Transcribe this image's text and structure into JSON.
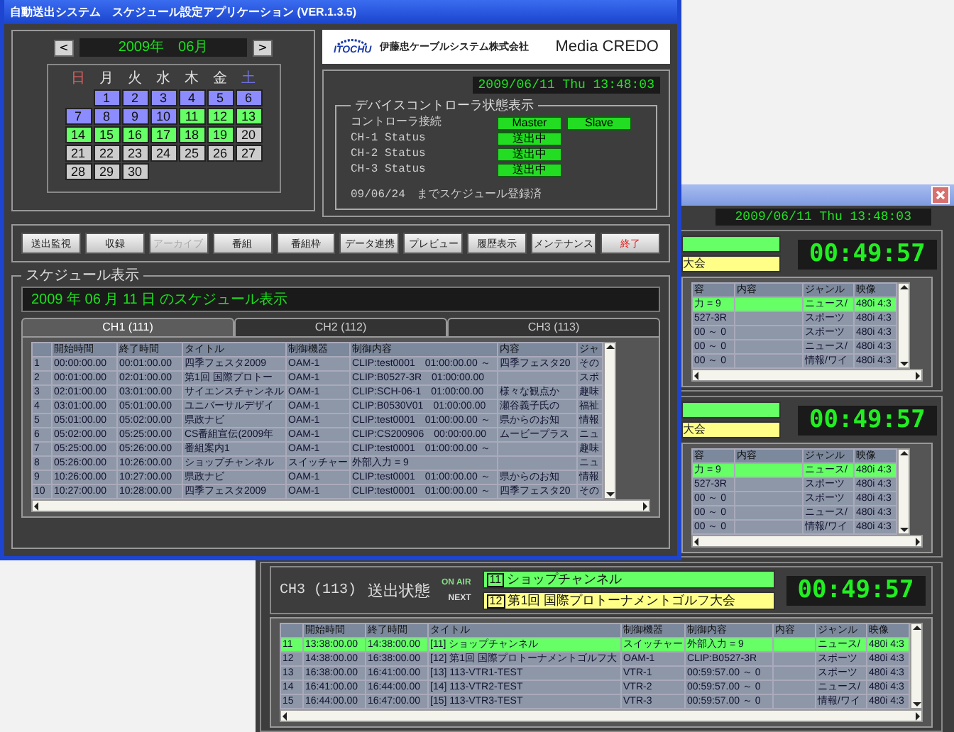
{
  "main_window": {
    "title": "自動送出システム　スケジュール設定アプリケーション (VER.1.3.5)",
    "calendar": {
      "prev": "<",
      "month": "2009年　06月",
      "next": ">",
      "weekdays": [
        {
          "label": "日",
          "kind": "sunday"
        },
        {
          "label": "月",
          "kind": "weekday"
        },
        {
          "label": "火",
          "kind": "weekday"
        },
        {
          "label": "水",
          "kind": "weekday"
        },
        {
          "label": "木",
          "kind": "weekday"
        },
        {
          "label": "金",
          "kind": "weekday"
        },
        {
          "label": "土",
          "kind": "saturday"
        }
      ],
      "weeks": [
        [
          {
            "kind": "empty"
          },
          {
            "day": "1",
            "color": "#8c8cff"
          },
          {
            "day": "2",
            "color": "#8c8cff"
          },
          {
            "day": "3",
            "color": "#8c8cff"
          },
          {
            "day": "4",
            "color": "#8c8cff"
          },
          {
            "day": "5",
            "color": "#8c8cff"
          },
          {
            "day": "6",
            "color": "#8c8cff"
          }
        ],
        [
          {
            "day": "7",
            "color": "#8c8cff"
          },
          {
            "day": "8",
            "color": "#8c8cff"
          },
          {
            "day": "9",
            "color": "#8c8cff"
          },
          {
            "day": "10",
            "color": "#8c8cff"
          },
          {
            "day": "11",
            "color": "#66ff66"
          },
          {
            "day": "12",
            "color": "#66ff66"
          },
          {
            "day": "13",
            "color": "#66ff66"
          }
        ],
        [
          {
            "day": "14",
            "color": "#66ff66"
          },
          {
            "day": "15",
            "color": "#66ff66"
          },
          {
            "day": "16",
            "color": "#66ff66"
          },
          {
            "day": "17",
            "color": "#66ff66"
          },
          {
            "day": "18",
            "color": "#66ff66"
          },
          {
            "day": "19",
            "color": "#66ff66"
          },
          {
            "day": "20",
            "color": "#cccccc"
          }
        ],
        [
          {
            "day": "21",
            "color": "#cccccc"
          },
          {
            "day": "22",
            "color": "#cccccc"
          },
          {
            "day": "23",
            "color": "#cccccc"
          },
          {
            "day": "24",
            "color": "#cccccc"
          },
          {
            "day": "25",
            "color": "#cccccc"
          },
          {
            "day": "26",
            "color": "#cccccc"
          },
          {
            "day": "27",
            "color": "#cccccc"
          }
        ],
        [
          {
            "day": "28",
            "color": "#cccccc"
          },
          {
            "day": "29",
            "color": "#cccccc"
          },
          {
            "day": "30",
            "color": "#cccccc"
          }
        ]
      ]
    },
    "logo": {
      "brand": "ITOCHU",
      "company": "伊藤忠ケーブルシステム株式会社",
      "product": "Media CREDO"
    },
    "clock": "2009/06/11 Thu 13:48:03",
    "device_status": {
      "title": "デバイスコントローラ状態表示",
      "rows": [
        {
          "label": "コントローラ接続",
          "indicators": [
            "Master",
            "Slave"
          ]
        },
        {
          "label": "CH-1 Status",
          "indicators": [
            "送出中"
          ]
        },
        {
          "label": "CH-2 Status",
          "indicators": [
            "送出中"
          ]
        },
        {
          "label": "CH-3 Status",
          "indicators": [
            "送出中"
          ]
        }
      ],
      "note": "09/06/24　までスケジュール登録済"
    },
    "buttons": [
      {
        "label": "送出監視",
        "kind": "normal",
        "disabled": false
      },
      {
        "label": "収録",
        "kind": "normal",
        "disabled": false
      },
      {
        "label": "アーカイブ",
        "kind": "normal",
        "disabled": true
      },
      {
        "label": "番組",
        "kind": "normal",
        "disabled": false
      },
      {
        "label": "番組枠",
        "kind": "normal",
        "disabled": false
      },
      {
        "label": "データ連携",
        "kind": "normal",
        "disabled": false
      },
      {
        "label": "プレビュー",
        "kind": "normal",
        "disabled": false
      },
      {
        "label": "履歴表示",
        "kind": "normal",
        "disabled": false
      },
      {
        "label": "メンテナンス",
        "kind": "normal",
        "disabled": false
      },
      {
        "label": "終了",
        "kind": "exit",
        "disabled": false
      }
    ],
    "schedule": {
      "title": "スケジュール表示",
      "banner": "2009 年 06 月 11 日 のスケジュール表示",
      "tabs": [
        {
          "label": "CH1 (111)",
          "selected": true
        },
        {
          "label": "CH2 (112)",
          "selected": false
        },
        {
          "label": "CH3 (113)",
          "selected": false
        }
      ],
      "columns": [
        "開始時間",
        "終了時間",
        "タイトル",
        "制御機器",
        "制御内容",
        "内容",
        "ジャ"
      ],
      "rows": [
        {
          "no": "1",
          "start": "00:00:00.00",
          "end": "00:01:00.00",
          "title": "四季フェスタ2009",
          "device": "OAM-1",
          "control": "CLIP:test0001　01:00:00.00 ～",
          "content": "四季フェスタ20",
          "genre": "その"
        },
        {
          "no": "2",
          "start": "00:01:00.00",
          "end": "02:01:00.00",
          "title": "第1回 国際プロトー",
          "device": "OAM-1",
          "control": "CLIP:B0527-3R　01:00:00.00",
          "genre": "スポ"
        },
        {
          "no": "3",
          "start": "02:01:00.00",
          "end": "03:01:00.00",
          "title": "サイエンスチャンネル",
          "device": "OAM-1",
          "control": "CLIP:SCH-06-1　01:00:00.00",
          "content": "様々な観点か",
          "genre": "趣味"
        },
        {
          "no": "4",
          "start": "03:01:00.00",
          "end": "05:01:00.00",
          "title": "ユニバーサルデザイ",
          "device": "OAM-1",
          "control": "CLIP:B0530V01　01:00:00.00",
          "content": "瀬谷義子氏の",
          "genre": "福祉"
        },
        {
          "no": "5",
          "start": "05:01:00.00",
          "end": "05:02:00.00",
          "title": "県政ナビ",
          "device": "OAM-1",
          "control": "CLIP:test0001　01:00:00.00 ～",
          "content": "県からのお知",
          "genre": "情報"
        },
        {
          "no": "6",
          "start": "05:02:00.00",
          "end": "05:25:00.00",
          "title": "CS番組宣伝(2009年",
          "device": "OAM-1",
          "control": "CLIP:CS200906　00:00:00.00",
          "content": "ムービープラス",
          "genre": "ニュ"
        },
        {
          "no": "7",
          "start": "05:25:00.00",
          "end": "05:26:00.00",
          "title": "番組案内1",
          "device": "OAM-1",
          "control": "CLIP:test0001　01:00:00.00 ～",
          "genre": "趣味"
        },
        {
          "no": "8",
          "start": "05:26:00.00",
          "end": "10:26:00.00",
          "title": "ショップチャンネル",
          "device": "スイッチャー",
          "control": "外部入力 = 9",
          "genre": "ニュ"
        },
        {
          "no": "9",
          "start": "10:26:00.00",
          "end": "10:27:00.00",
          "title": "県政ナビ",
          "device": "OAM-1",
          "control": "CLIP:test0001　01:00:00.00 ～",
          "content": "県からのお知",
          "genre": "情報"
        },
        {
          "no": "10",
          "start": "10:27:00.00",
          "end": "10:28:00.00",
          "title": "四季フェスタ2009",
          "device": "OAM-1",
          "control": "CLIP:test0001　01:00:00.00 ～",
          "content": "四季フェスタ20",
          "genre": "その"
        }
      ]
    }
  },
  "monitor_window": {
    "clock": "2009/06/11 Thu 13:48:03",
    "channels": [
      {
        "kind": "partial",
        "next_fragment": "大会",
        "timer": "00:49:57",
        "columns": [
          "容",
          "内容",
          "ジャンル",
          "映像"
        ],
        "rows": [
          {
            "control": "力 = 9",
            "genre": "ニュース/",
            "video": "480i 4:3",
            "onair": true
          },
          {
            "control": "527-3R",
            "genre": "スポーツ",
            "video": "480i 4:3",
            "onair": false
          },
          {
            "control": "00 ～ 0",
            "genre": "スポーツ",
            "video": "480i 4:3",
            "onair": false
          },
          {
            "control": "00 ～ 0",
            "genre": "ニュース/",
            "video": "480i 4:3",
            "onair": false
          },
          {
            "control": "00 ～ 0",
            "genre": "情報/ワイ",
            "video": "480i 4:3",
            "onair": false
          }
        ]
      },
      {
        "kind": "partial",
        "next_fragment": "大会",
        "timer": "00:49:57",
        "columns": [
          "容",
          "内容",
          "ジャンル",
          "映像"
        ],
        "rows": [
          {
            "control": "力 = 9",
            "genre": "ニュース/",
            "video": "480i 4:3",
            "onair": true
          },
          {
            "control": "527-3R",
            "genre": "スポーツ",
            "video": "480i 4:3",
            "onair": false
          },
          {
            "control": "00 ～ 0",
            "genre": "スポーツ",
            "video": "480i 4:3",
            "onair": false
          },
          {
            "control": "00 ～ 0",
            "genre": "ニュース/",
            "video": "480i 4:3",
            "onair": false
          },
          {
            "control": "00 ～ 0",
            "genre": "情報/ワイ",
            "video": "480i 4:3",
            "onair": false
          }
        ]
      },
      {
        "kind": "full",
        "name": "CH3 (113)",
        "state_label": "送出状態",
        "onair_label": "ON AIR",
        "next_label": "NEXT",
        "onair": {
          "number": "11",
          "title": "ショップチャンネル"
        },
        "next": {
          "number": "12",
          "title": "第1回 国際プロトーナメントゴルフ大会"
        },
        "timer": "00:49:57",
        "columns": [
          "開始時間",
          "終了時間",
          "タイトル",
          "制御機器",
          "制御内容",
          "内容",
          "ジャンル",
          "映像"
        ],
        "rows": [
          {
            "no": "11",
            "start": "13:38:00.00",
            "end": "14:38:00.00",
            "title": "[11] ショップチャンネル",
            "device": "スイッチャー",
            "control": "外部入力 = 9",
            "genre": "ニュース/",
            "video": "480i 4:3",
            "onair": true
          },
          {
            "no": "12",
            "start": "14:38:00.00",
            "end": "16:38:00.00",
            "title": "[12] 第1回 国際プロトーナメントゴルフ大",
            "device": "OAM-1",
            "control": "CLIP:B0527-3R",
            "genre": "スポーツ",
            "video": "480i 4:3",
            "onair": false
          },
          {
            "no": "13",
            "start": "16:38:00.00",
            "end": "16:41:00.00",
            "title": "[13] 113-VTR1-TEST",
            "device": "VTR-1",
            "control": "00:59:57.00 ～ 0",
            "genre": "スポーツ",
            "video": "480i 4:3",
            "onair": false
          },
          {
            "no": "14",
            "start": "16:41:00.00",
            "end": "16:44:00.00",
            "title": "[14] 113-VTR2-TEST",
            "device": "VTR-2",
            "control": "00:59:57.00 ～ 0",
            "genre": "ニュース/",
            "video": "480i 4:3",
            "onair": false
          },
          {
            "no": "15",
            "start": "16:44:00.00",
            "end": "16:47:00.00",
            "title": "[15] 113-VTR3-TEST",
            "device": "VTR-3",
            "control": "00:59:57.00 ～ 0",
            "genre": "情報/ワイ",
            "video": "480i 4:3",
            "onair": false
          }
        ]
      }
    ]
  }
}
